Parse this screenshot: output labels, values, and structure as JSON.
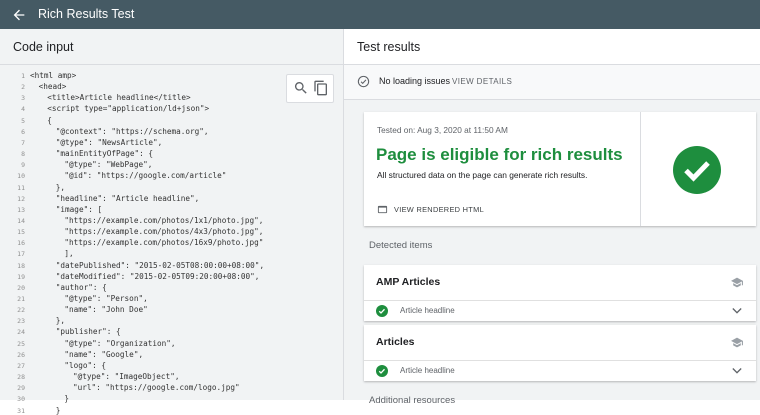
{
  "app": {
    "title": "Rich Results Test"
  },
  "code_panel": {
    "title": "Code input",
    "lines": [
      {
        "n": "1",
        "t": "<html amp>",
        "i": 0
      },
      {
        "n": "2",
        "t": "<head>",
        "i": 1
      },
      {
        "n": "3",
        "t": "<title>Article headline</title>",
        "i": 2
      },
      {
        "n": "4",
        "t": "<script type=\"application/ld+json\">",
        "i": 2
      },
      {
        "n": "5",
        "t": "{",
        "i": 2
      },
      {
        "n": "6",
        "t": "\"@context\": \"https://schema.org\",",
        "i": 3
      },
      {
        "n": "7",
        "t": "\"@type\": \"NewsArticle\",",
        "i": 3
      },
      {
        "n": "8",
        "t": "\"mainEntityOfPage\": {",
        "i": 3
      },
      {
        "n": "9",
        "t": "\"@type\": \"WebPage\",",
        "i": 4
      },
      {
        "n": "10",
        "t": "\"@id\": \"https://google.com/article\"",
        "i": 4
      },
      {
        "n": "11",
        "t": "},",
        "i": 3
      },
      {
        "n": "12",
        "t": "\"headline\": \"Article headline\",",
        "i": 3
      },
      {
        "n": "13",
        "t": "\"image\": [",
        "i": 3
      },
      {
        "n": "14",
        "t": "\"https://example.com/photos/1x1/photo.jpg\",",
        "i": 4
      },
      {
        "n": "15",
        "t": "\"https://example.com/photos/4x3/photo.jpg\",",
        "i": 4
      },
      {
        "n": "16",
        "t": "\"https://example.com/photos/16x9/photo.jpg\"",
        "i": 4
      },
      {
        "n": "17",
        "t": "],",
        "i": 4
      },
      {
        "n": "18",
        "t": "\"datePublished\": \"2015-02-05T08:00:00+08:00\",",
        "i": 3
      },
      {
        "n": "19",
        "t": "\"dateModified\": \"2015-02-05T09:20:00+08:00\",",
        "i": 3
      },
      {
        "n": "20",
        "t": "\"author\": {",
        "i": 3
      },
      {
        "n": "21",
        "t": "\"@type\": \"Person\",",
        "i": 4
      },
      {
        "n": "22",
        "t": "\"name\": \"John Doe\"",
        "i": 4
      },
      {
        "n": "23",
        "t": "},",
        "i": 3
      },
      {
        "n": "24",
        "t": "\"publisher\": {",
        "i": 3
      },
      {
        "n": "25",
        "t": "\"@type\": \"Organization\",",
        "i": 4
      },
      {
        "n": "26",
        "t": "\"name\": \"Google\",",
        "i": 4
      },
      {
        "n": "27",
        "t": "\"logo\": {",
        "i": 4
      },
      {
        "n": "28",
        "t": "\"@type\": \"ImageObject\",",
        "i": 5
      },
      {
        "n": "29",
        "t": "\"url\": \"https://google.com/logo.jpg\"",
        "i": 5
      },
      {
        "n": "30",
        "t": "}",
        "i": 4
      },
      {
        "n": "31",
        "t": "}",
        "i": 3
      }
    ]
  },
  "results": {
    "title": "Test results",
    "status": {
      "text": "No loading issues",
      "action": "VIEW DETAILS"
    },
    "summary": {
      "tested_on": "Tested on: Aug 3, 2020 at 11:50 AM",
      "headline": "Page is eligible for rich results",
      "description": "All structured data on the page can generate rich results.",
      "view_rendered": "VIEW RENDERED HTML"
    },
    "detected_label": "Detected items",
    "items": [
      {
        "title": "AMP Articles",
        "sub": "Article headline"
      },
      {
        "title": "Articles",
        "sub": "Article headline"
      }
    ],
    "additional_label": "Additional resources"
  },
  "colors": {
    "topbar": "#455a64",
    "success": "#1e8e3e",
    "panel": "#f1f3f4"
  },
  "icons": [
    "back-arrow-icon",
    "search-icon",
    "copy-icon",
    "check-circle-outline-icon",
    "web-page-icon",
    "check-circle-icon",
    "school-cap-icon",
    "chevron-down-icon"
  ]
}
